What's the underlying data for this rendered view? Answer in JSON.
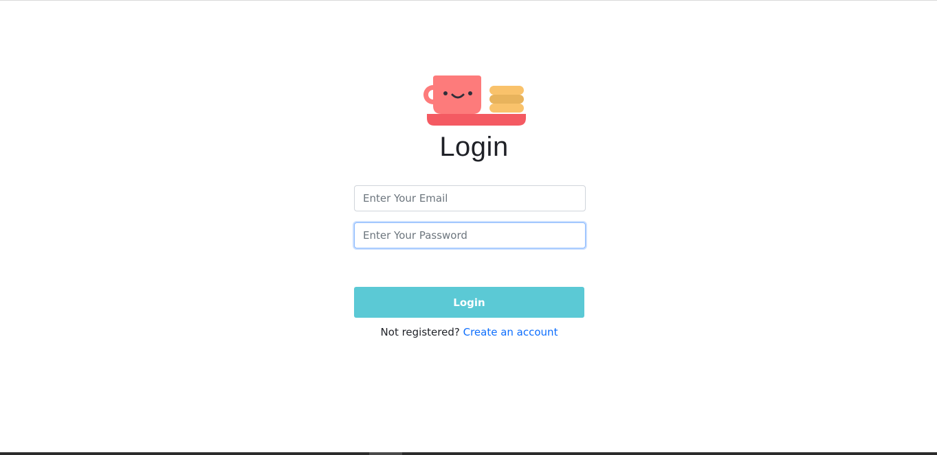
{
  "logo": {
    "icon": "coffee-cup-with-cookies-icon"
  },
  "page": {
    "title": "Login"
  },
  "form": {
    "email_placeholder": "Enter Your Email",
    "password_placeholder": "Enter Your Password",
    "submit_label": "Login",
    "register_prompt": "Not registered?",
    "register_link": "Create an account"
  },
  "colors": {
    "button": "#5bc9d5",
    "link": "#0d6efd",
    "cup": "#fd7b7b",
    "saucer": "#f45a62",
    "cookie": "#f9c26b"
  }
}
